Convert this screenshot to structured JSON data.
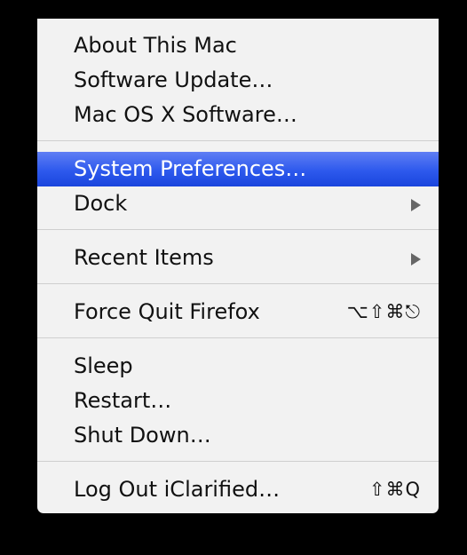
{
  "menu": {
    "groups": [
      [
        "About This Mac",
        "Software Update…",
        "Mac OS X Software…"
      ],
      [
        "System Preferences…",
        "Dock"
      ],
      [
        "Recent Items"
      ],
      [
        "Force Quit Firefox"
      ],
      [
        "Sleep",
        "Restart…",
        "Shut Down…"
      ],
      [
        "Log Out iClarified…"
      ]
    ],
    "selected_item": "System Preferences…",
    "submenu_items": [
      "Dock",
      "Recent Items"
    ],
    "shortcuts": {
      "force_quit": "⌥⇧⌘⎋",
      "log_out": "⇧⌘Q"
    },
    "colors": {
      "background": "#000000",
      "menu_background": "#f2f2f2",
      "highlight": "#2d59ed"
    }
  }
}
